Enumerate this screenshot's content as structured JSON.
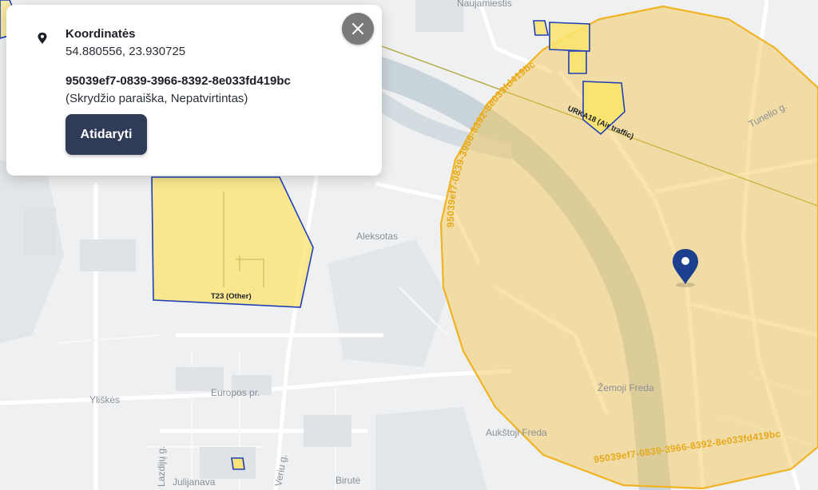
{
  "popup": {
    "coords_title": "Koordinatės",
    "coords_value": "54.880556, 23.930725",
    "application_id": "95039ef7-0839-3966-8392-8e033fd419bc",
    "application_status": "(Skrydžio paraiška, Nepatvirtintas)",
    "open_button": "Atidaryti"
  },
  "map": {
    "place_labels": {
      "naujamiestis": "Naujamiestis",
      "aleksotas": "Aleksotas",
      "yliskes": "Yliškės",
      "europos": "Europos pr.",
      "zemoji_freda": "Žemoji Freda",
      "aukstoji_freda": "Aukštoji Freda",
      "julijanava": "Julijanava",
      "birute": "Birutė",
      "tunelio": "Tunelio g.",
      "lazdynu": "Lazdijų g.",
      "veriu": "Veriu g."
    },
    "zone_labels": {
      "t23": "T23 (Other)",
      "urka18": "URKA18 (Air traffic)"
    },
    "ring_label_top": "95039ef7-0839-3966-8392-8e033fd419bc",
    "ring_label_left": "95039ef7-0839-3966-8392-8e033fd419bc",
    "ring_label_bottom": "95039ef7-0839-3966-8392-8e033fd419bc",
    "colors": {
      "ring_fill": "#f4c447",
      "ring_stroke": "#f0b323",
      "zone_fill": "#fbe46c",
      "zone_stroke": "#1f3fb8",
      "pin": "#1c3f8f",
      "water": "#c7d3d9",
      "land": "#eef0f2",
      "road": "#ffffff"
    },
    "icons": [
      "location-pin-icon",
      "close-icon",
      "map-marker-icon"
    ]
  }
}
